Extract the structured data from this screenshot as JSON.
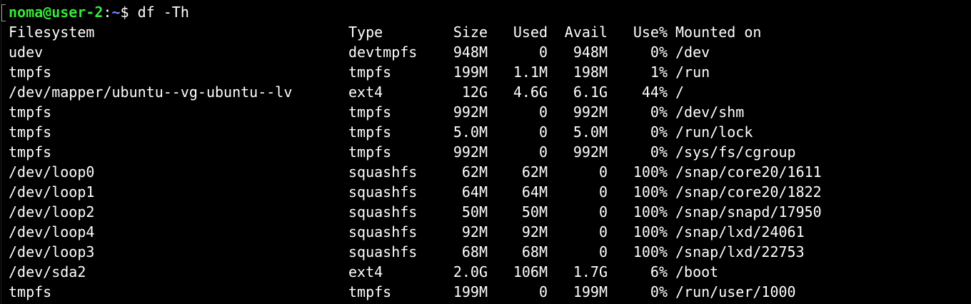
{
  "terminal": {
    "user_host": "noma@user-2",
    "colon": ":",
    "cwd": "~",
    "sign": "$",
    "command": "df -Th",
    "headers": {
      "filesystem": "Filesystem",
      "type": "Type",
      "size": "Size",
      "used": "Used",
      "avail": "Avail",
      "use": "Use%",
      "mounted": "Mounted on"
    },
    "rows": [
      {
        "filesystem": "udev",
        "type": "devtmpfs",
        "size": "948M",
        "used": "0",
        "avail": "948M",
        "use": "0%",
        "mounted": "/dev"
      },
      {
        "filesystem": "tmpfs",
        "type": "tmpfs",
        "size": "199M",
        "used": "1.1M",
        "avail": "198M",
        "use": "1%",
        "mounted": "/run"
      },
      {
        "filesystem": "/dev/mapper/ubuntu--vg-ubuntu--lv",
        "type": "ext4",
        "size": "12G",
        "used": "4.6G",
        "avail": "6.1G",
        "use": "44%",
        "mounted": "/"
      },
      {
        "filesystem": "tmpfs",
        "type": "tmpfs",
        "size": "992M",
        "used": "0",
        "avail": "992M",
        "use": "0%",
        "mounted": "/dev/shm"
      },
      {
        "filesystem": "tmpfs",
        "type": "tmpfs",
        "size": "5.0M",
        "used": "0",
        "avail": "5.0M",
        "use": "0%",
        "mounted": "/run/lock"
      },
      {
        "filesystem": "tmpfs",
        "type": "tmpfs",
        "size": "992M",
        "used": "0",
        "avail": "992M",
        "use": "0%",
        "mounted": "/sys/fs/cgroup"
      },
      {
        "filesystem": "/dev/loop0",
        "type": "squashfs",
        "size": "62M",
        "used": "62M",
        "avail": "0",
        "use": "100%",
        "mounted": "/snap/core20/1611"
      },
      {
        "filesystem": "/dev/loop1",
        "type": "squashfs",
        "size": "64M",
        "used": "64M",
        "avail": "0",
        "use": "100%",
        "mounted": "/snap/core20/1822"
      },
      {
        "filesystem": "/dev/loop2",
        "type": "squashfs",
        "size": "50M",
        "used": "50M",
        "avail": "0",
        "use": "100%",
        "mounted": "/snap/snapd/17950"
      },
      {
        "filesystem": "/dev/loop4",
        "type": "squashfs",
        "size": "92M",
        "used": "92M",
        "avail": "0",
        "use": "100%",
        "mounted": "/snap/lxd/24061"
      },
      {
        "filesystem": "/dev/loop3",
        "type": "squashfs",
        "size": "68M",
        "used": "68M",
        "avail": "0",
        "use": "100%",
        "mounted": "/snap/lxd/22753"
      },
      {
        "filesystem": "/dev/sda2",
        "type": "ext4",
        "size": "2.0G",
        "used": "106M",
        "avail": "1.7G",
        "use": "6%",
        "mounted": "/boot"
      },
      {
        "filesystem": "tmpfs",
        "type": "tmpfs",
        "size": "199M",
        "used": "0",
        "avail": "199M",
        "use": "0%",
        "mounted": "/run/user/1000"
      }
    ]
  }
}
